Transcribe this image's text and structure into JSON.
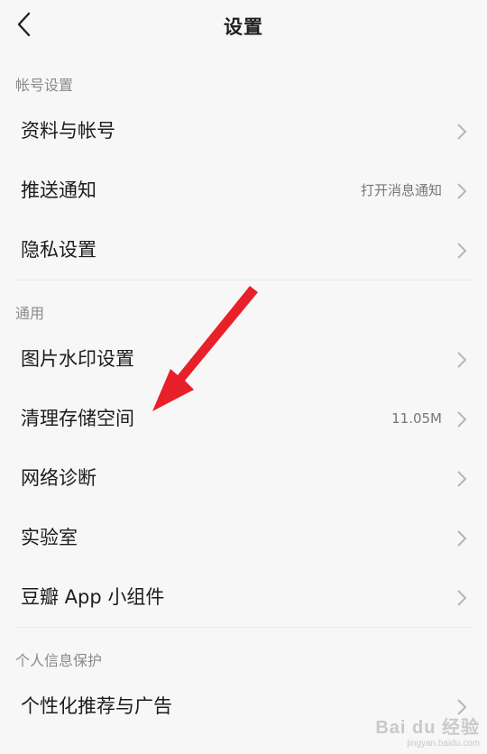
{
  "header": {
    "title": "设置",
    "back_icon": "chevron-left-icon"
  },
  "sections": [
    {
      "label": "帐号设置",
      "items": [
        {
          "label": "资料与帐号",
          "value": ""
        },
        {
          "label": "推送通知",
          "value": "打开消息通知"
        },
        {
          "label": "隐私设置",
          "value": ""
        }
      ]
    },
    {
      "label": "通用",
      "items": [
        {
          "label": "图片水印设置",
          "value": ""
        },
        {
          "label": "清理存储空间",
          "value": "11.05M"
        },
        {
          "label": "网络诊断",
          "value": ""
        },
        {
          "label": "实验室",
          "value": ""
        },
        {
          "label": "豆瓣 App 小组件",
          "value": ""
        }
      ]
    },
    {
      "label": "个人信息保护",
      "items": [
        {
          "label": "个性化推荐与广告",
          "value": ""
        }
      ]
    }
  ],
  "annotation": {
    "color": "#e8202a"
  },
  "watermark": {
    "logo": "Bai du 经验",
    "url": "jingyan.baidu.com"
  }
}
